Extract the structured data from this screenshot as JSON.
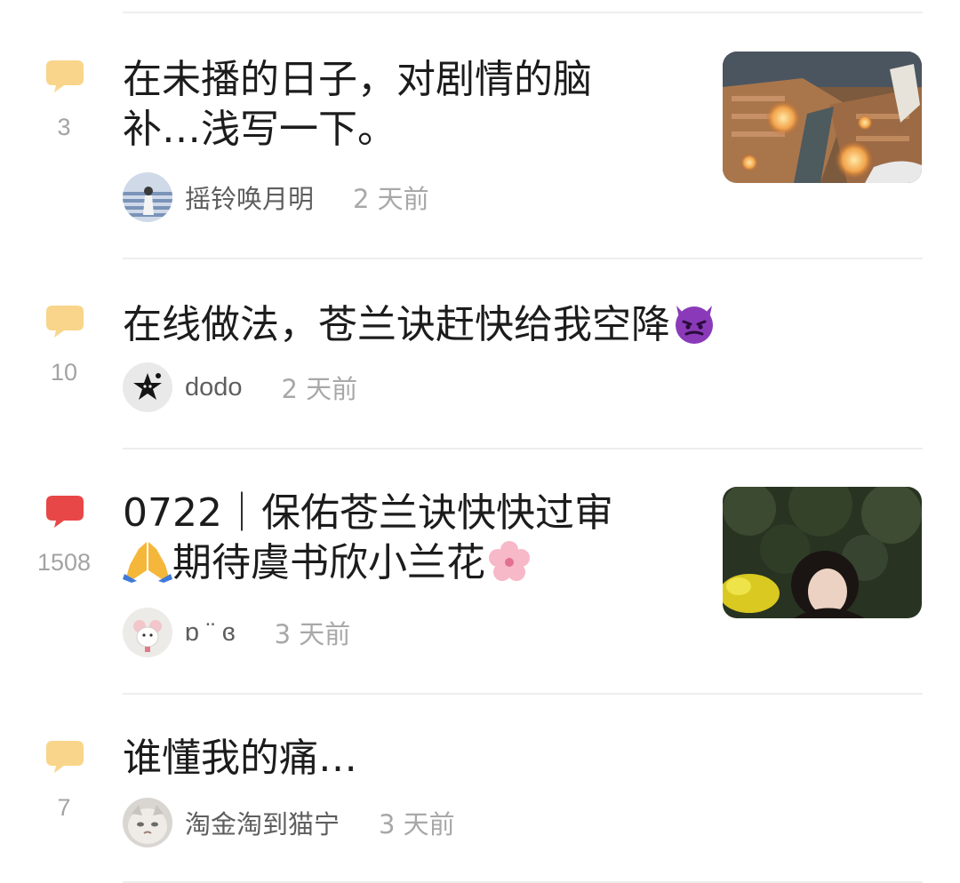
{
  "posts": [
    {
      "comment_count": "3",
      "title": "在未播的日子，对剧情的脑补…浅写一下。",
      "author": "摇铃唤月明",
      "time": "2 天前",
      "comment_icon_color": "#f8d58a"
    },
    {
      "comment_count": "10",
      "title": "在线做法，苍兰诀赶快给我空降",
      "title_emoji": "smiling-face-with-horns-icon",
      "author": "dodo",
      "time": "2 天前",
      "comment_icon_color": "#f8d58a"
    },
    {
      "comment_count": "1508",
      "title_line1": "0722｜保佑苍兰诀快快过审",
      "title_line2": "期待虞书欣小兰花",
      "title_emojis": [
        "folded-hands-icon",
        "cherry-blossom-icon"
      ],
      "author": "ɒ ¨ ɞ",
      "time": "3 天前",
      "comment_icon_color": "#e84747"
    },
    {
      "comment_count": "7",
      "title": "谁懂我的痛…",
      "author": "淘金淘到猫宁",
      "time": "3 天前",
      "comment_icon_color": "#f8d58a"
    }
  ]
}
